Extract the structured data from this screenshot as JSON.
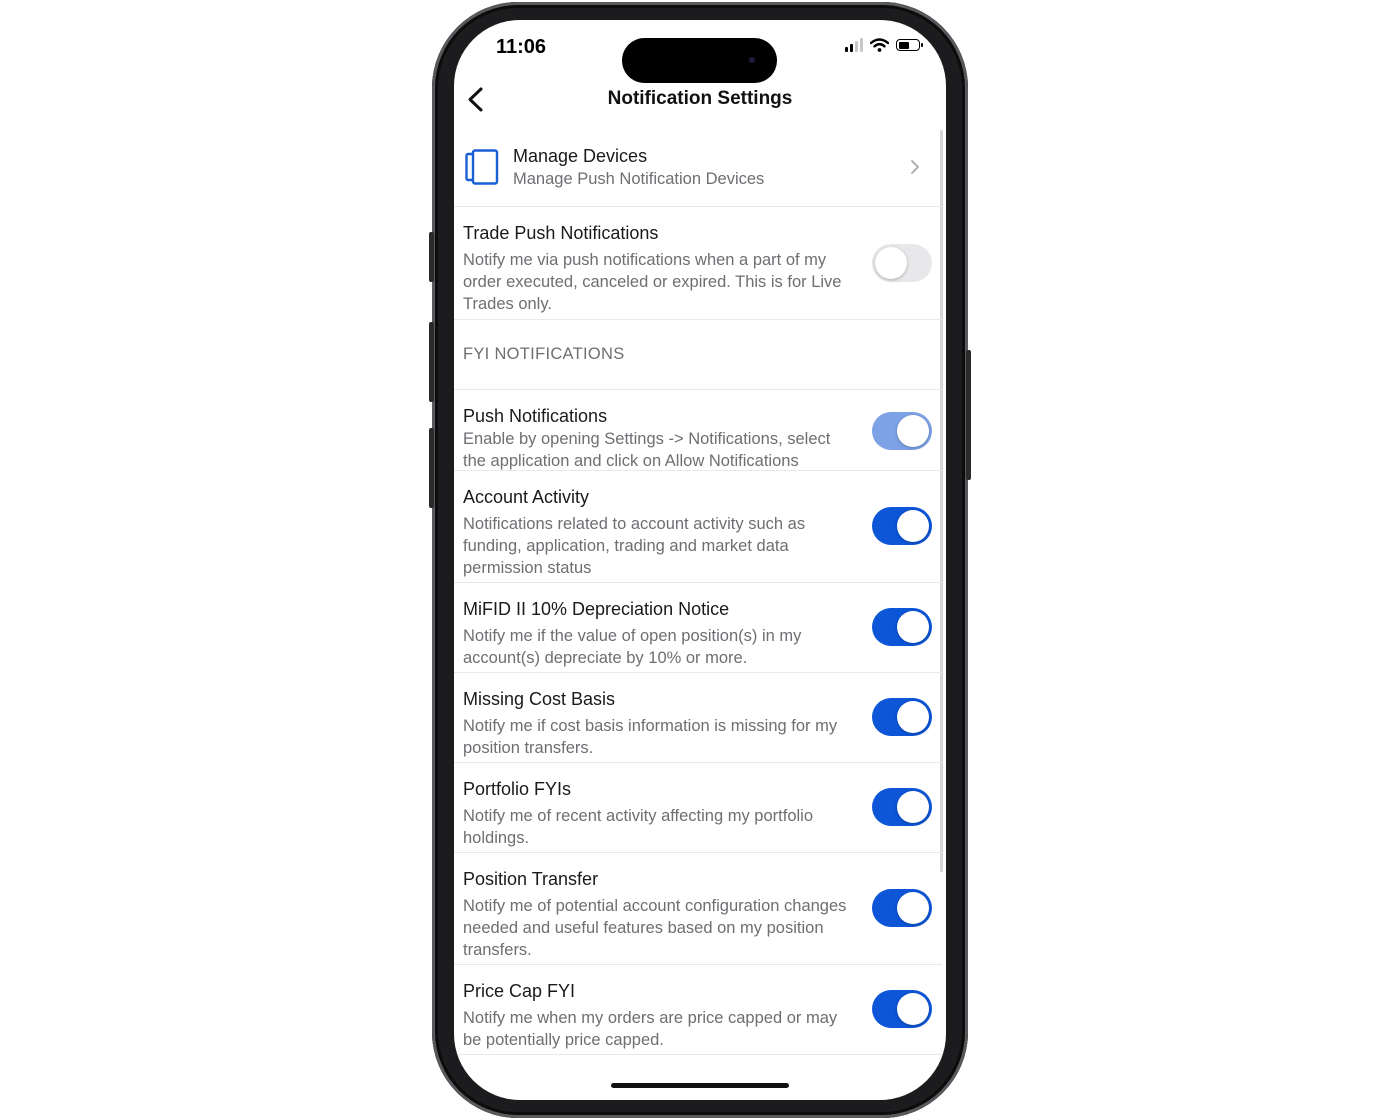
{
  "status_bar": {
    "time": "11:06"
  },
  "nav": {
    "title": "Notification Settings"
  },
  "manage_devices": {
    "title": "Manage Devices",
    "subtitle": "Manage Push Notification Devices"
  },
  "trade_push": {
    "title": "Trade Push Notifications",
    "description": "Notify me via push notifications when a part of my order executed, canceled or expired. This is for Live Trades only.",
    "enabled": false
  },
  "section_header": "FYI NOTIFICATIONS",
  "settings": [
    {
      "title": "Push Notifications",
      "description": "Enable by opening Settings -> Notifications, select the application and click on Allow Notifications",
      "enabled": true
    },
    {
      "title": "Account Activity",
      "description": "Notifications related to account activity such as funding, application, trading and market data permission status",
      "enabled": true
    },
    {
      "title": "MiFID II 10% Depreciation Notice",
      "description": "Notify me if the value of open position(s) in my account(s) depreciate by 10% or more.",
      "enabled": true
    },
    {
      "title": "Missing Cost Basis",
      "description": "Notify me if cost basis information is missing for my position transfers.",
      "enabled": true
    },
    {
      "title": "Portfolio FYIs",
      "description": "Notify me of recent activity affecting my portfolio holdings.",
      "enabled": true
    },
    {
      "title": "Position Transfer",
      "description": "Notify me of potential account configuration changes needed and useful features based on my position transfers.",
      "enabled": true
    },
    {
      "title": "Price Cap FYI",
      "description": "Notify me when my orders are price capped or may be potentially price capped.",
      "enabled": true
    }
  ],
  "colors": {
    "accent": "#0d56d8",
    "accent_disabled": "#7da3e6",
    "toggle_off": "#e8e8ea"
  }
}
